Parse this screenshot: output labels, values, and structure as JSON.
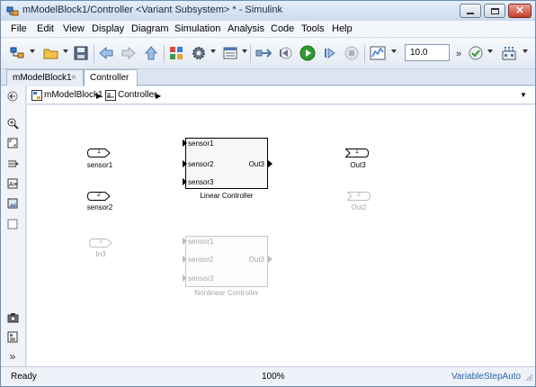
{
  "window": {
    "title": "mModelBlock1/Controller <Variant Subsystem> * - Simulink",
    "controls": {
      "minimize": "minimize",
      "maximize": "maximize",
      "close": "close"
    }
  },
  "menu": [
    "File",
    "Edit",
    "View",
    "Display",
    "Diagram",
    "Simulation",
    "Analysis",
    "Code",
    "Tools",
    "Help"
  ],
  "toolbar": {
    "stop_time": "10.0",
    "overflow": "»"
  },
  "tabs": [
    {
      "label": "mModelBlock1",
      "close": "×",
      "active": false
    },
    {
      "label": "Controller",
      "active": true
    }
  ],
  "breadcrumb": {
    "items": [
      "mModelBlock1",
      "Controller"
    ],
    "separator": "▶",
    "dropdown": "▼"
  },
  "canvas": {
    "inports": [
      {
        "number": "1",
        "label": "sensor1",
        "active": true
      },
      {
        "number": "2",
        "label": "sensor2",
        "active": true
      },
      {
        "number": "3",
        "label": "In3",
        "active": false
      }
    ],
    "outports": [
      {
        "number": "1",
        "label": "Out3",
        "active": true
      },
      {
        "number": "2",
        "label": "Out2",
        "active": false
      }
    ],
    "blocks": [
      {
        "caption": "Linear Controller",
        "inputs": [
          "sensor1",
          "sensor2",
          "sensor3"
        ],
        "output": "Out3",
        "active": true
      },
      {
        "caption": "Nonlinear Controller",
        "inputs": [
          "sensor1",
          "sensor2",
          "sensor3"
        ],
        "output": "Out3",
        "active": false
      }
    ]
  },
  "status": {
    "state": "Ready",
    "zoom": "100%",
    "solver": "VariableStepAuto"
  },
  "colors": {
    "accent": "#2a64a8",
    "run_green": "#2f9a2f",
    "inactive_gray": "#a8a8a8"
  }
}
